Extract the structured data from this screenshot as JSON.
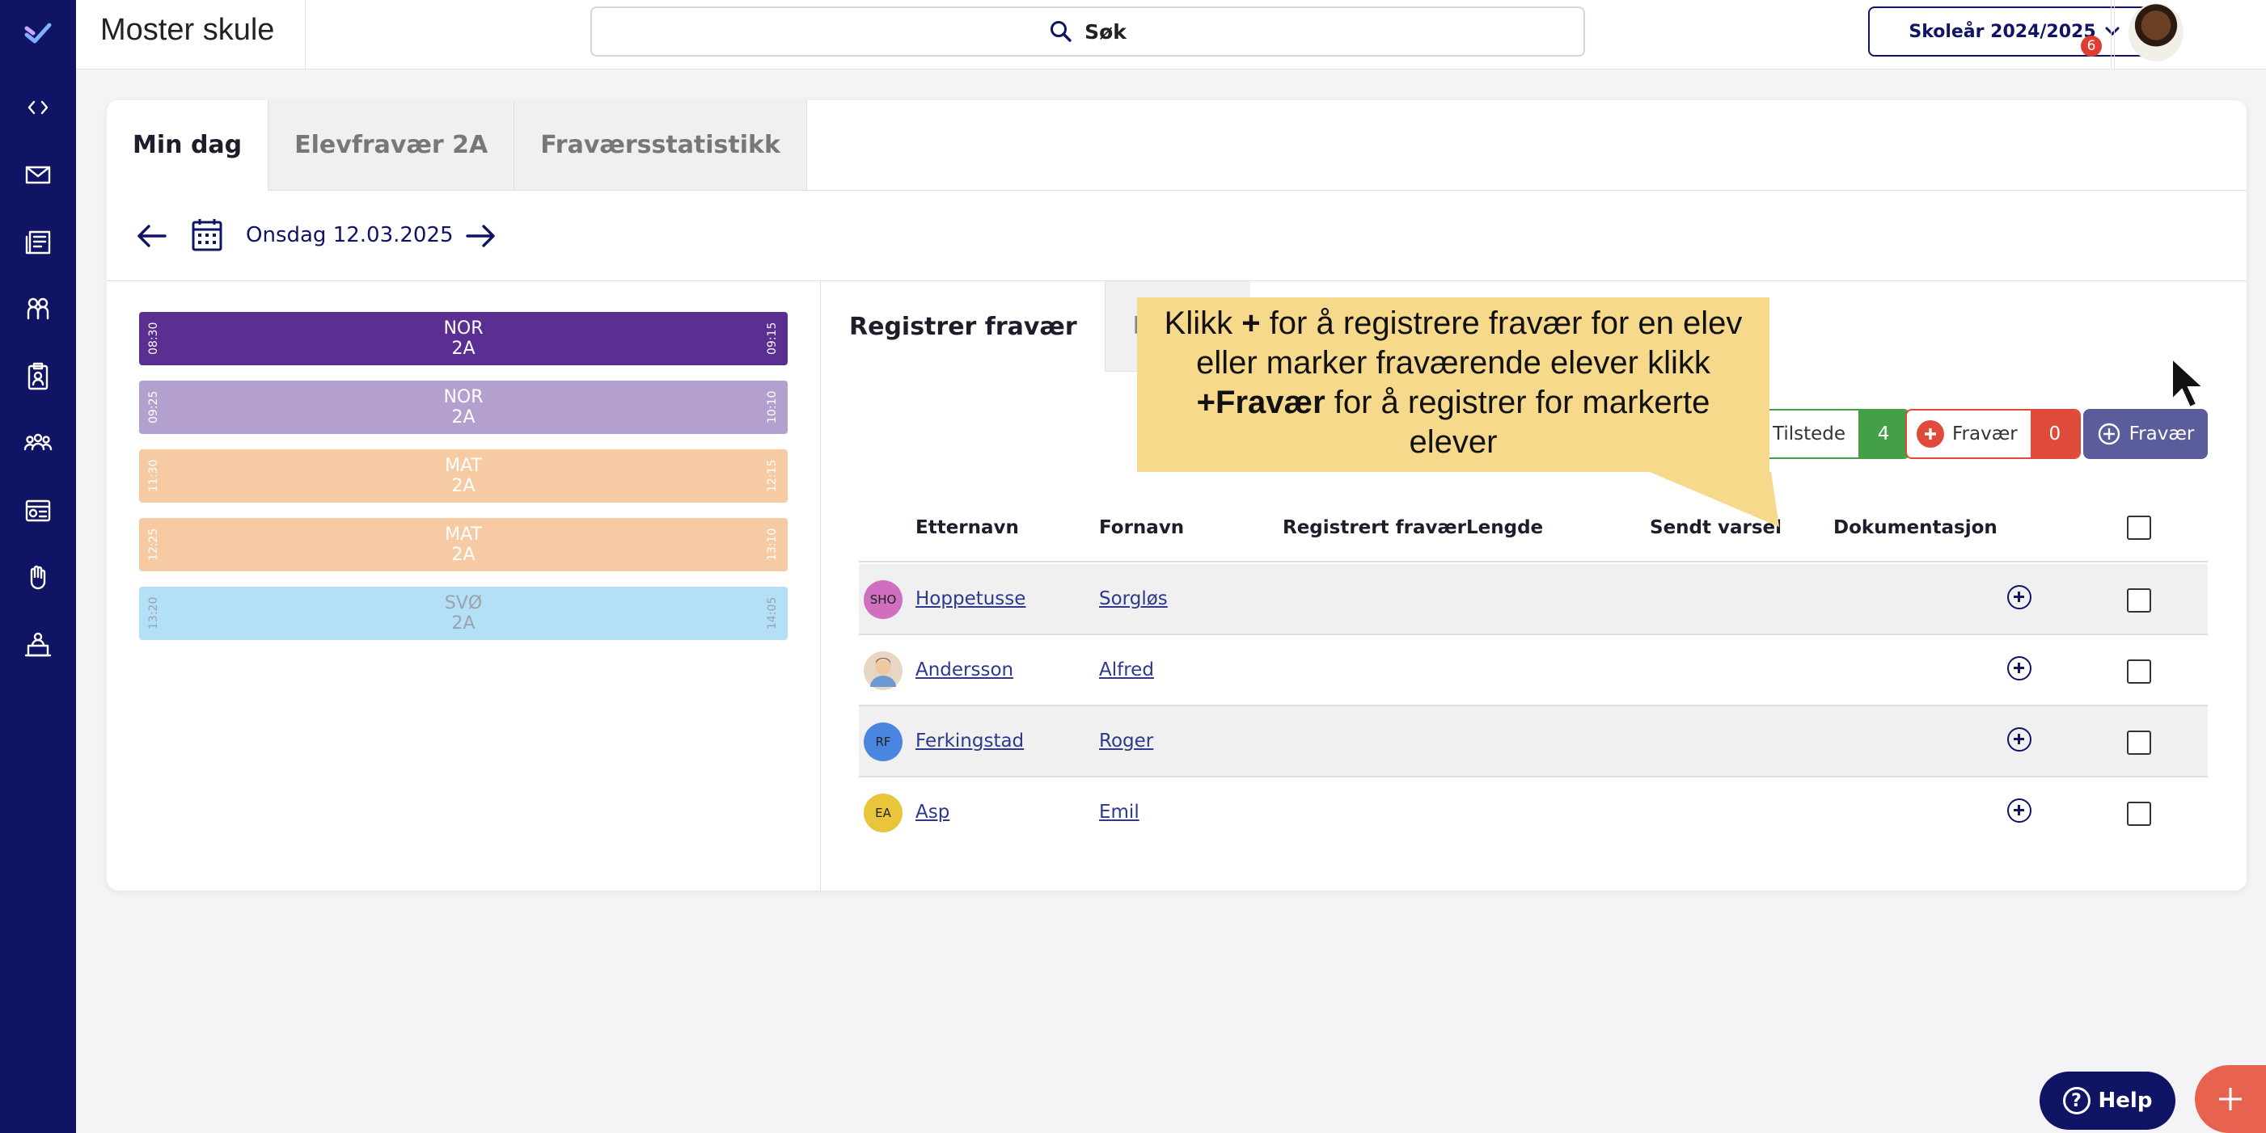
{
  "topbar": {
    "school_name": "Moster skule",
    "search_label": "Søk",
    "school_year": "Skoleår 2024/2025",
    "mail_count": "6"
  },
  "tabs": [
    {
      "label": "Min dag",
      "active": true
    },
    {
      "label": "Elevfravær 2A",
      "active": false
    },
    {
      "label": "Fraværsstatistikk",
      "active": false
    }
  ],
  "date": "Onsdag 12.03.2025",
  "lessons": [
    {
      "subject": "NOR",
      "group": "2A",
      "start": "08:30",
      "end": "09:15",
      "color": "#5b2e91",
      "text_color": "#ffffff"
    },
    {
      "subject": "NOR",
      "group": "2A",
      "start": "09:25",
      "end": "10:10",
      "color": "#b3a0cf",
      "text_color": "#ffffff"
    },
    {
      "subject": "MAT",
      "group": "2A",
      "start": "11:30",
      "end": "12:15",
      "color": "#f6cba3",
      "text_color": "#ffffff"
    },
    {
      "subject": "MAT",
      "group": "2A",
      "start": "12:25",
      "end": "13:10",
      "color": "#f6cba3",
      "text_color": "#ffffff"
    },
    {
      "subject": "SVØ",
      "group": "2A",
      "start": "13:20",
      "end": "14:05",
      "color": "#b3e0f7",
      "text_color": "#9aa3ad"
    }
  ],
  "subtabs": [
    {
      "label": "Registrer fravær",
      "active": true
    },
    {
      "label": "Reserv",
      "active": false
    }
  ],
  "counters": {
    "present_label": "Tilstede",
    "present_count": "4",
    "absent_label": "Fravær",
    "absent_count": "0",
    "add_absence_label": "Fravær"
  },
  "table": {
    "headers": [
      "Etternavn",
      "Fornavn",
      "Registrert fravær",
      "Lengde",
      "Sendt varsel",
      "Dokumentasjon"
    ],
    "rows": [
      {
        "initials": "SHO",
        "avatar_color": "#d06fc0",
        "last_name": "Hoppetusse",
        "first_name": "Sorgløs"
      },
      {
        "initials": "",
        "avatar_color": "#f0c8a8",
        "last_name": "Andersson",
        "first_name": "Alfred"
      },
      {
        "initials": "RF",
        "avatar_color": "#4a86e0",
        "last_name": "Ferkingstad",
        "first_name": "Roger"
      },
      {
        "initials": "EA",
        "avatar_color": "#e8c53a",
        "last_name": "Asp",
        "first_name": "Emil"
      }
    ]
  },
  "tooltip": {
    "line1_a": "Klikk ",
    "line1_b": "+",
    "line1_c": " for å registrere fravær for en elev",
    "line2": "eller marker fraværende elever klikk",
    "line3_a": "+Fravær",
    "line3_b": " for å registrer for markerte",
    "line4": "elever"
  },
  "help_label": "Help"
}
